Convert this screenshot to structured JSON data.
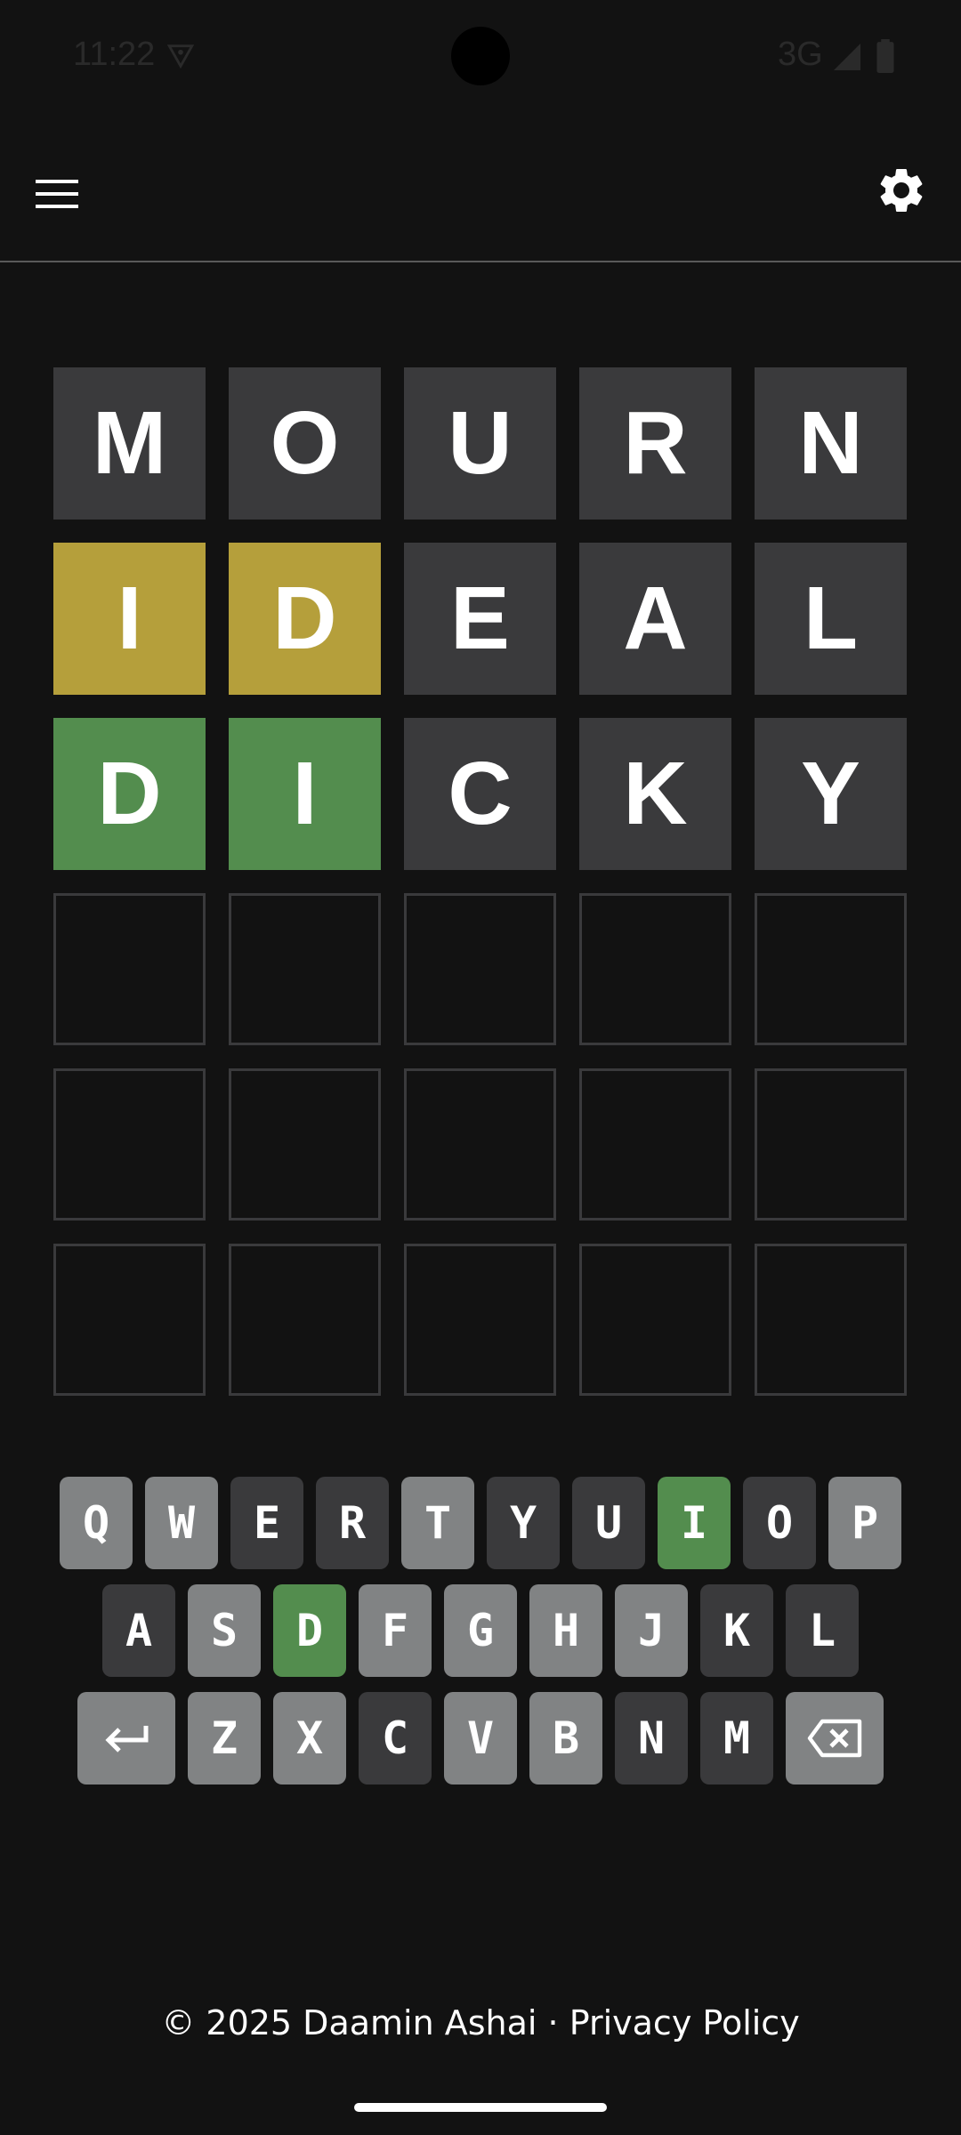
{
  "status_bar": {
    "time": "11:22",
    "network": "3G"
  },
  "header": {
    "menu_icon": "hamburger-menu-icon",
    "settings_icon": "gear-icon"
  },
  "board": {
    "rows": [
      [
        {
          "letter": "M",
          "state": "absent"
        },
        {
          "letter": "O",
          "state": "absent"
        },
        {
          "letter": "U",
          "state": "absent"
        },
        {
          "letter": "R",
          "state": "absent"
        },
        {
          "letter": "N",
          "state": "absent"
        }
      ],
      [
        {
          "letter": "I",
          "state": "present"
        },
        {
          "letter": "D",
          "state": "present"
        },
        {
          "letter": "E",
          "state": "absent"
        },
        {
          "letter": "A",
          "state": "absent"
        },
        {
          "letter": "L",
          "state": "absent"
        }
      ],
      [
        {
          "letter": "D",
          "state": "correct"
        },
        {
          "letter": "I",
          "state": "correct"
        },
        {
          "letter": "C",
          "state": "absent"
        },
        {
          "letter": "K",
          "state": "absent"
        },
        {
          "letter": "Y",
          "state": "absent"
        }
      ],
      [
        {
          "letter": "",
          "state": "empty"
        },
        {
          "letter": "",
          "state": "empty"
        },
        {
          "letter": "",
          "state": "empty"
        },
        {
          "letter": "",
          "state": "empty"
        },
        {
          "letter": "",
          "state": "empty"
        }
      ],
      [
        {
          "letter": "",
          "state": "empty"
        },
        {
          "letter": "",
          "state": "empty"
        },
        {
          "letter": "",
          "state": "empty"
        },
        {
          "letter": "",
          "state": "empty"
        },
        {
          "letter": "",
          "state": "empty"
        }
      ],
      [
        {
          "letter": "",
          "state": "empty"
        },
        {
          "letter": "",
          "state": "empty"
        },
        {
          "letter": "",
          "state": "empty"
        },
        {
          "letter": "",
          "state": "empty"
        },
        {
          "letter": "",
          "state": "empty"
        }
      ]
    ]
  },
  "keyboard": {
    "rows": [
      [
        {
          "label": "Q",
          "state": "unused"
        },
        {
          "label": "W",
          "state": "unused"
        },
        {
          "label": "E",
          "state": "absent"
        },
        {
          "label": "R",
          "state": "absent"
        },
        {
          "label": "T",
          "state": "unused"
        },
        {
          "label": "Y",
          "state": "absent"
        },
        {
          "label": "U",
          "state": "absent"
        },
        {
          "label": "I",
          "state": "correct"
        },
        {
          "label": "O",
          "state": "absent"
        },
        {
          "label": "P",
          "state": "unused"
        }
      ],
      [
        {
          "label": "A",
          "state": "absent"
        },
        {
          "label": "S",
          "state": "unused"
        },
        {
          "label": "D",
          "state": "correct"
        },
        {
          "label": "F",
          "state": "unused"
        },
        {
          "label": "G",
          "state": "unused"
        },
        {
          "label": "H",
          "state": "unused"
        },
        {
          "label": "J",
          "state": "unused"
        },
        {
          "label": "K",
          "state": "absent"
        },
        {
          "label": "L",
          "state": "absent"
        }
      ],
      [
        {
          "label": "↵",
          "state": "unused",
          "key": "enter",
          "wide": true
        },
        {
          "label": "Z",
          "state": "unused"
        },
        {
          "label": "X",
          "state": "unused"
        },
        {
          "label": "C",
          "state": "absent"
        },
        {
          "label": "V",
          "state": "unused"
        },
        {
          "label": "B",
          "state": "unused"
        },
        {
          "label": "N",
          "state": "absent"
        },
        {
          "label": "M",
          "state": "absent"
        },
        {
          "label": "",
          "state": "unused",
          "key": "backspace",
          "wide": true
        }
      ]
    ]
  },
  "footer": {
    "copyright": "© 2025 Daamin Ashai",
    "separator": " · ",
    "privacy_link": "Privacy Policy"
  },
  "colors": {
    "background": "#121212",
    "absent": "#3a3a3c",
    "present": "#b59f3b",
    "correct": "#538d4e",
    "unused_key": "#818384",
    "empty_border": "#3a3a3c"
  }
}
